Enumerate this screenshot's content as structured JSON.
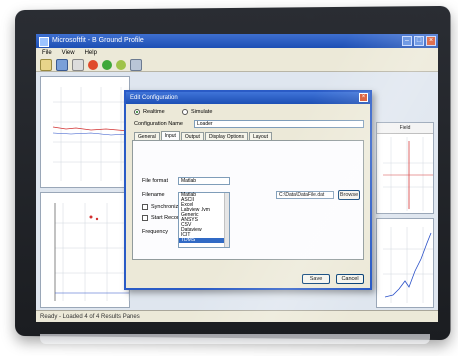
{
  "app": {
    "title": "Microsoftfit - B Ground Profile",
    "menu": [
      "File",
      "View",
      "Help"
    ],
    "status": "Ready - Loaded 4 of 4 Results Panes"
  },
  "panels": {
    "right_header": "Field"
  },
  "dialog": {
    "title": "Edit Configuration",
    "close": "×",
    "mode_options": [
      "Realtime",
      "Simulate"
    ],
    "config_name_label": "Configuration Name",
    "config_name_value": "Loader",
    "tabs": [
      "General",
      "Input",
      "Output",
      "Display Options",
      "Layout"
    ],
    "file_format_label": "File format",
    "file_format_value": "Matlab",
    "filename_label": "Filename",
    "filename_value": "C:\\Data\\DataFile.dat",
    "browse_label": "Browse",
    "option1_label": "Synchronize",
    "option2_label": "Start Recording",
    "frequency_label": "Frequency",
    "list_items": [
      "Matlab",
      "ASCII",
      "Excel",
      "Labview .lvm",
      "Generic",
      "ANSYS",
      "CSV",
      "Dataview",
      "ICIT",
      "TDMS"
    ],
    "selected_index": 9,
    "ok_label": "Save",
    "cancel_label": "Cancel"
  }
}
